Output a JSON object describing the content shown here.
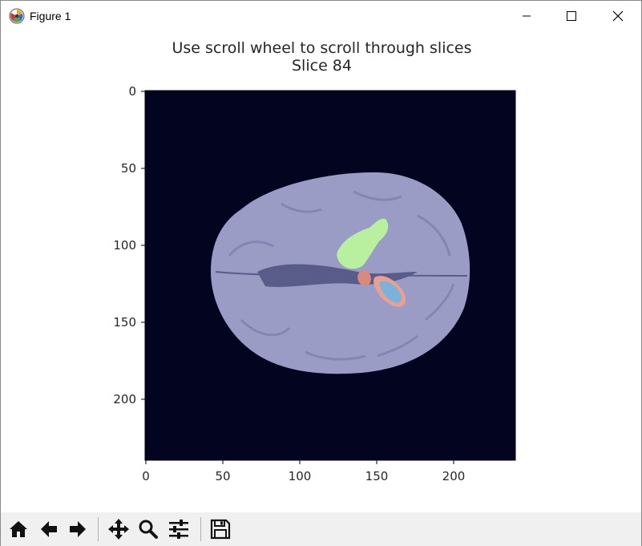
{
  "window": {
    "title": "Figure 1",
    "controls": [
      "minimize",
      "maximize",
      "close"
    ]
  },
  "plot": {
    "title_line1": "Use scroll wheel to scroll through slices",
    "title_line2": "Slice 84",
    "x_ticks": [
      "0",
      "50",
      "100",
      "150",
      "200"
    ],
    "y_ticks": [
      "0",
      "50",
      "100",
      "150",
      "200"
    ]
  },
  "colors": {
    "background": "#03041f",
    "brain": "#9a9cc6",
    "edema_green": "#b8f0a0",
    "core_red": "#e08a80",
    "enhancing_blue": "#7ab2dc"
  },
  "toolbar": {
    "buttons": [
      {
        "name": "home",
        "icon": "home-icon"
      },
      {
        "name": "back",
        "icon": "arrow-left-icon"
      },
      {
        "name": "forward",
        "icon": "arrow-right-icon"
      },
      {
        "name": "pan",
        "icon": "move-icon"
      },
      {
        "name": "zoom",
        "icon": "magnifier-icon"
      },
      {
        "name": "configure-subplots",
        "icon": "sliders-icon"
      },
      {
        "name": "save",
        "icon": "floppy-disk-icon"
      }
    ]
  }
}
